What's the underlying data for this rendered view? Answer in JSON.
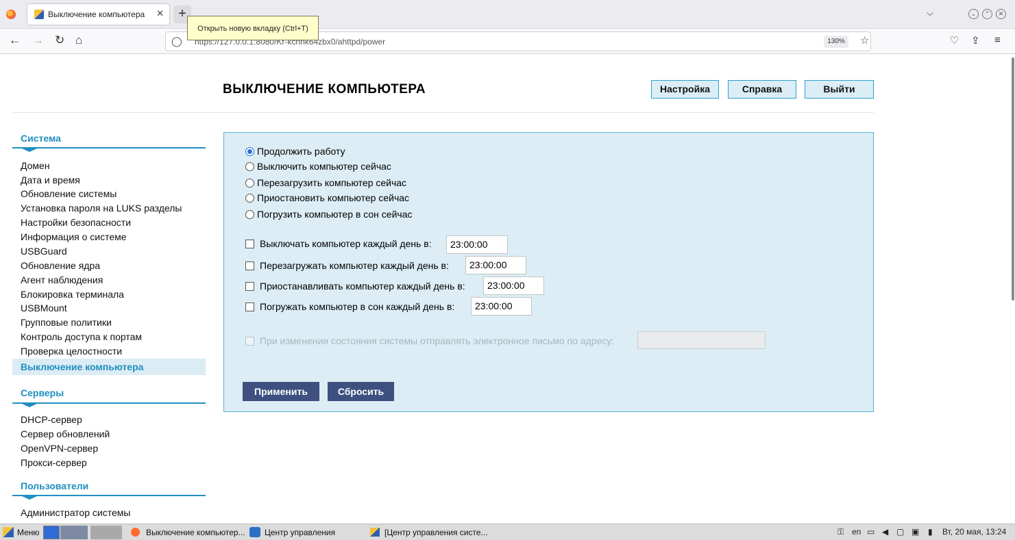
{
  "browser": {
    "tab_title": "Выключение компьютера",
    "tab_close": "✕",
    "new_tab": "+",
    "tooltip": "Открыть новую вкладку (Ctrl+T)",
    "url": "https://127.0.0.1:8080/Kr-kcnnk64zbx0/ahttpd/power",
    "zoom": "130%"
  },
  "page": {
    "title": "ВЫКЛЮЧЕНИЕ КОМПЬЮТЕРА",
    "buttons": {
      "settings": "Настройка",
      "help": "Справка",
      "logout": "Выйти"
    }
  },
  "sidebar": {
    "system": {
      "title": "Система",
      "items": [
        "Домен",
        "Дата и время",
        "Обновление системы",
        "Установка пароля на LUKS разделы",
        "Настройки безопасности",
        "Информация о системе",
        "USBGuard",
        "Обновление ядра",
        "Агент наблюдения",
        "Блокировка терминала",
        "USBMount",
        "Групповые политики",
        "Контроль доступа к портам",
        "Проверка целостности"
      ],
      "active": "Выключение компьютера"
    },
    "servers": {
      "title": "Серверы",
      "items": [
        "DHCP-сервер",
        "Сервер обновлений",
        "OpenVPN-сервер",
        "Прокси-сервер"
      ]
    },
    "users": {
      "title": "Пользователи",
      "items": [
        "Администратор системы"
      ]
    }
  },
  "form": {
    "radios": [
      "Продолжить работу",
      "Выключить компьютер сейчас",
      "Перезагрузить компьютер сейчас",
      "Приостановить компьютер сейчас",
      "Погрузить компьютер в сон сейчас"
    ],
    "selected_radio": "Продолжить работу",
    "schedules": [
      {
        "label": "Выключать компьютер каждый день в:",
        "time": "23:00:00",
        "checked": false
      },
      {
        "label": "Перезагружать компьютер каждый день в:",
        "time": "23:00:00",
        "checked": false
      },
      {
        "label": "Приостанавливать компьютер каждый день в:",
        "time": "23:00:00",
        "checked": false
      },
      {
        "label": "Погружать компьютер в сон каждый день в:",
        "time": "23:00:00",
        "checked": false
      }
    ],
    "email_label": "При изменении состояния системы отправлять электронное письмо по адресу:",
    "email_value": "",
    "apply": "Применить",
    "reset": "Сбросить"
  },
  "taskbar": {
    "menu": "Меню",
    "windows": [
      "Выключение компьютер...",
      "Центр управления",
      "[Центр управления систе..."
    ],
    "lang": "en",
    "clock": "Вт, 20 мая, 13:24"
  }
}
